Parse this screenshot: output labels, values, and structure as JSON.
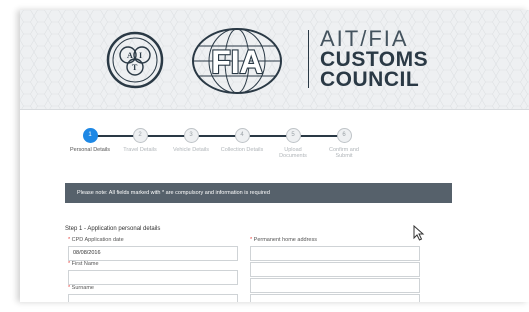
{
  "brand": {
    "line1": "AIT/FIA",
    "line2": "CUSTOMS",
    "line3": "COUNCIL",
    "ait_logo_text": "AIT",
    "fia_logo_text": "FIA"
  },
  "steps": [
    {
      "number": "1",
      "label": "Personal Details",
      "active": true
    },
    {
      "number": "2",
      "label": "Travel Details",
      "active": false
    },
    {
      "number": "3",
      "label": "Vehicle Details",
      "active": false
    },
    {
      "number": "4",
      "label": "Collection Details",
      "active": false
    },
    {
      "number": "5",
      "label": "Upload Documents",
      "active": false
    },
    {
      "number": "6",
      "label": "Confirm and Submit",
      "active": false
    }
  ],
  "notice": "Please note: All fields marked with * are compulsory and information is required",
  "form": {
    "section_title": "Step 1 - Application personal details",
    "cpd_label": "CPD Application date",
    "cpd_value": "08/08/2016",
    "first_name_label": "First Name",
    "first_name_value": "",
    "surname_label": "Surname",
    "surname_value": "",
    "address_label": "Permanent home address",
    "required_mark": "*"
  },
  "colors": {
    "accent": "#1e88e5",
    "notice_bg": "#56616b",
    "brand_dark": "#2a3945",
    "required": "#e53935"
  }
}
